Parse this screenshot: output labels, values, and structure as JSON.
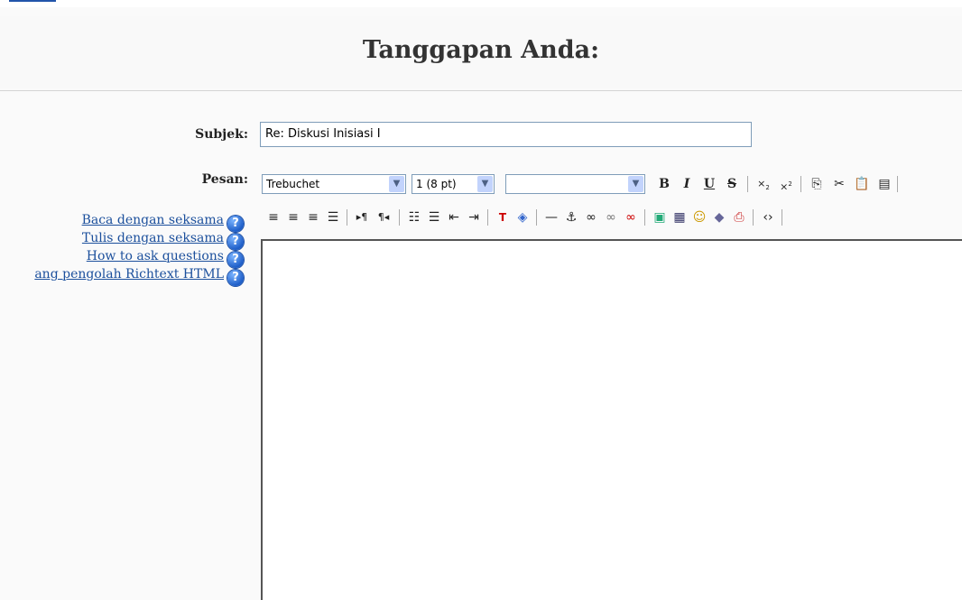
{
  "heading": "Tanggapan Anda:",
  "subject": {
    "label": "Subjek:",
    "value": "Re: Diskusi Inisiasi I"
  },
  "message": {
    "label": "Pesan:"
  },
  "toolbar": {
    "font_family": "Trebuchet",
    "font_size": "1 (8 pt)",
    "format": "",
    "row1_icons": [
      "bold-icon",
      "italic-icon",
      "underline-icon",
      "strikethrough-icon",
      "subscript-icon",
      "superscript-icon",
      "copy-icon",
      "cut-icon",
      "paste-icon",
      "paste-word-icon"
    ],
    "row2_icons": [
      "align-left-icon",
      "align-center-icon",
      "align-right-icon",
      "justify-icon",
      "ltr-icon",
      "rtl-icon",
      "ordered-list-icon",
      "unordered-list-icon",
      "outdent-icon",
      "indent-icon",
      "text-color-icon",
      "background-color-icon",
      "horizontal-rule-icon",
      "anchor-icon",
      "link-icon",
      "unlink-icon",
      "nolink-icon",
      "image-icon",
      "table-icon",
      "smiley-icon",
      "special-char-icon",
      "search-replace-icon",
      "html-source-icon"
    ]
  },
  "help_links": [
    "Baca dengan seksama",
    "Tulis dengan seksama",
    "How to ask questions",
    "ang pengolah Richtext HTML"
  ]
}
